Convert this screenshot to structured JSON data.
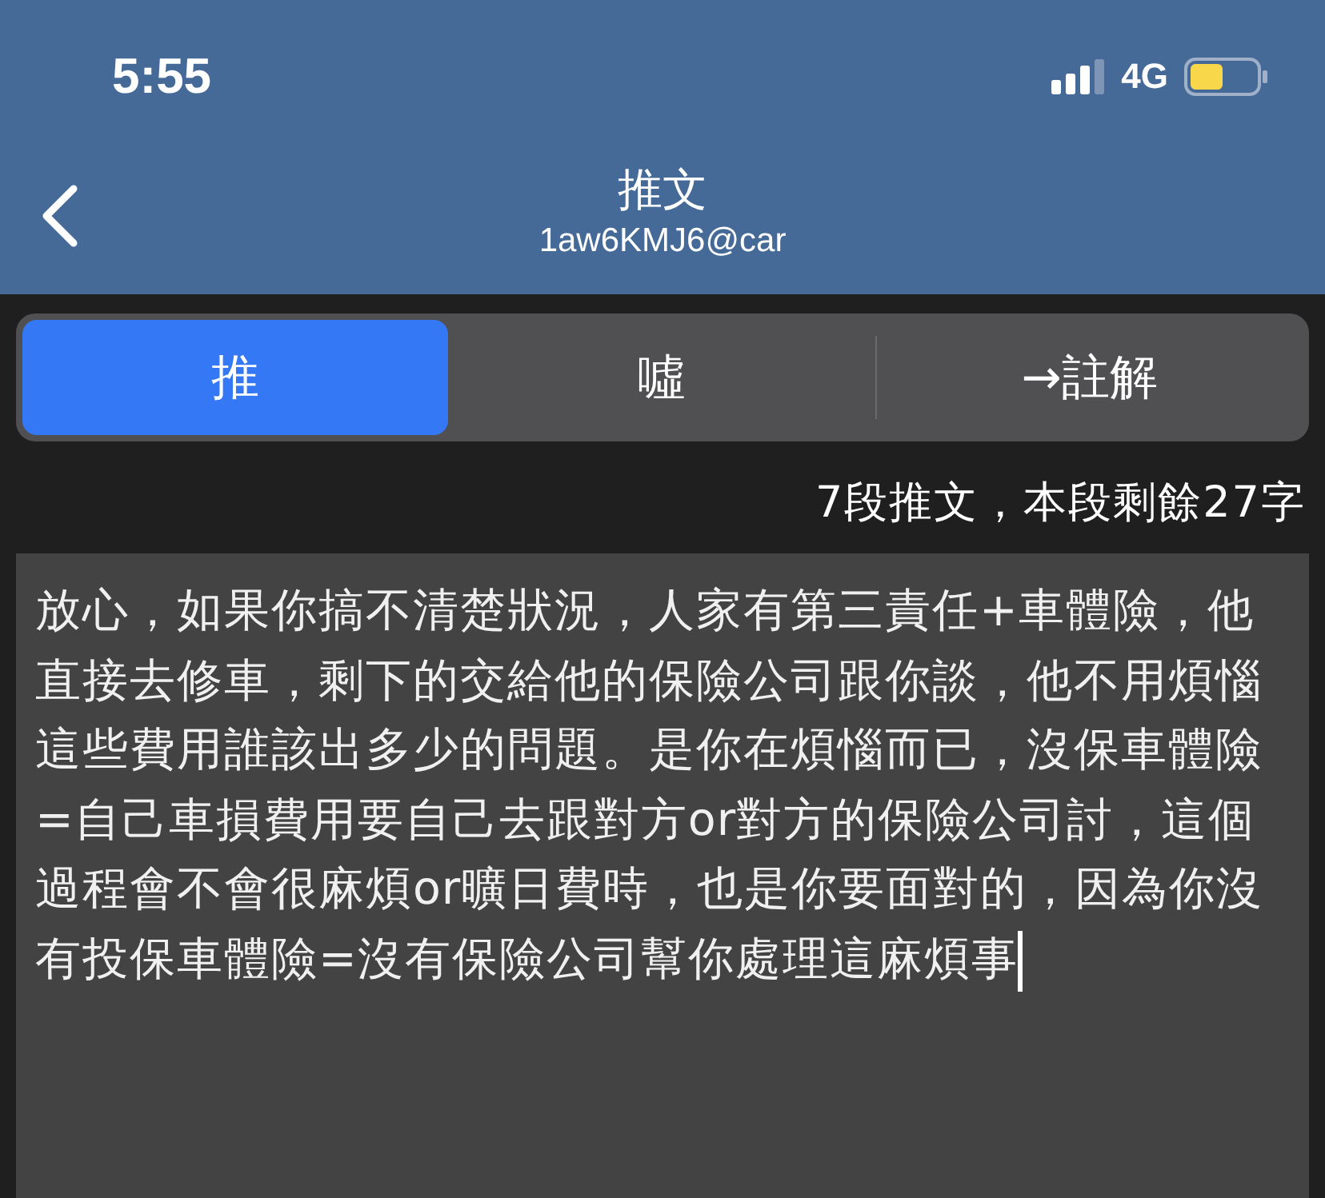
{
  "status_bar": {
    "time": "5:55",
    "network": "4G"
  },
  "nav": {
    "title": "推文",
    "subtitle": "1aw6KMJ6@car"
  },
  "tabs": [
    {
      "label": "推",
      "selected": true
    },
    {
      "label": "噓",
      "selected": false
    },
    {
      "label": "→註解",
      "selected": false
    }
  ],
  "counter": "7段推文，本段剩餘27字",
  "message": {
    "value": "放心，如果你搞不清楚狀況，人家有第三責任+車體險，他直接去修車，剩下的交給他的保險公司跟你談，他不用煩惱這些費用誰該出多少的問題。是你在煩惱而已，沒保車體險=自己車損費用要自己去跟對方or對方的保險公司討，這個過程會不會很麻煩or曠日費時，也是你要面對的，因為你沒有投保車體險=沒有保險公司幫你處理這麻煩事"
  }
}
